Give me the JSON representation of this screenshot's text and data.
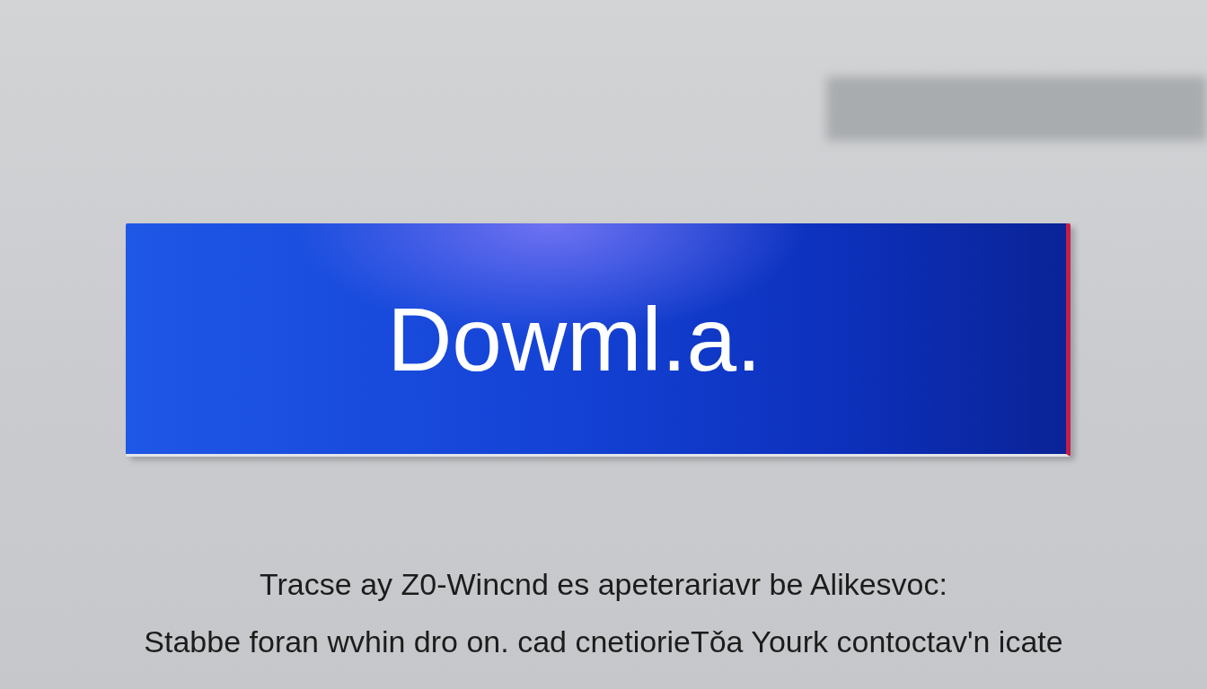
{
  "button": {
    "label": "Dowml.a."
  },
  "caption": {
    "lines": [
      "Tracse ay Z0-Wincnd es apeterariavr be Alikesvoc:",
      "Stabbe foran wvhin dro on. cad cnetiorieTǒa Yourk contoctav'n icate"
    ]
  }
}
